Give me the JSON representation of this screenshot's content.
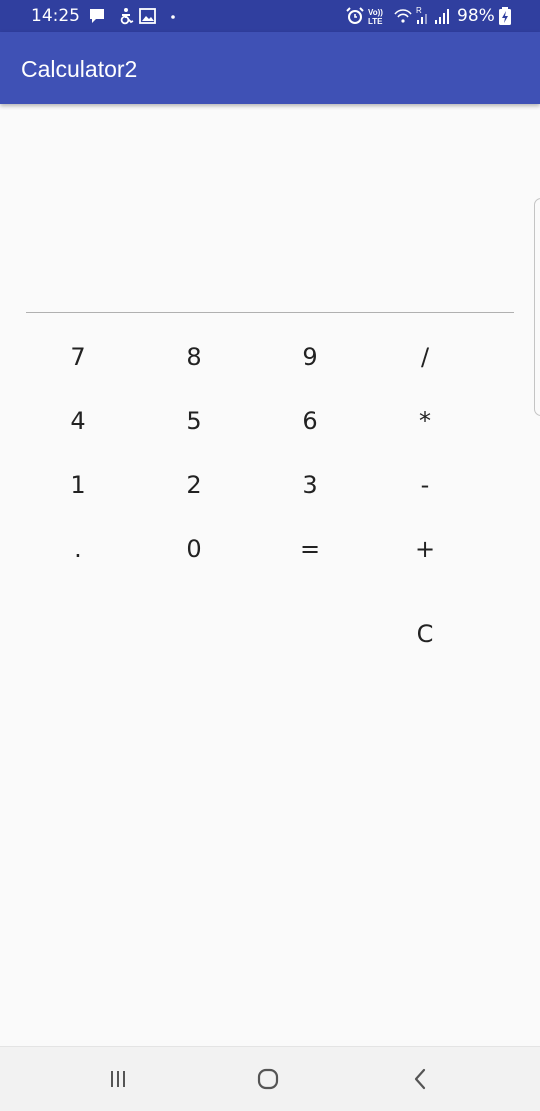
{
  "status_bar": {
    "time": "14:25",
    "battery_percent": "98%",
    "left_icons": [
      "chat-icon",
      "accessibility-icon",
      "image-icon",
      "dot-icon"
    ],
    "right_icons": [
      "alarm-icon",
      "volte-icon",
      "wifi-icon",
      "signal-icon",
      "battery-charging-icon"
    ],
    "volte_label": "Vo)) LTE",
    "roaming_label": "R"
  },
  "app_bar": {
    "title": "Calculator2",
    "color": "#3f51b5",
    "status_color": "#303f9f"
  },
  "display": {
    "value": ""
  },
  "keypad": {
    "row1": [
      "7",
      "8",
      "9",
      "/"
    ],
    "row2": [
      "4",
      "5",
      "6",
      "*"
    ],
    "row3": [
      "1",
      "2",
      "3",
      "-"
    ],
    "row4": [
      ".",
      "0",
      "=",
      "+"
    ],
    "row5": [
      "C"
    ]
  },
  "nav_bar": {
    "icons": [
      "recent-apps-icon",
      "home-icon",
      "back-icon"
    ]
  }
}
